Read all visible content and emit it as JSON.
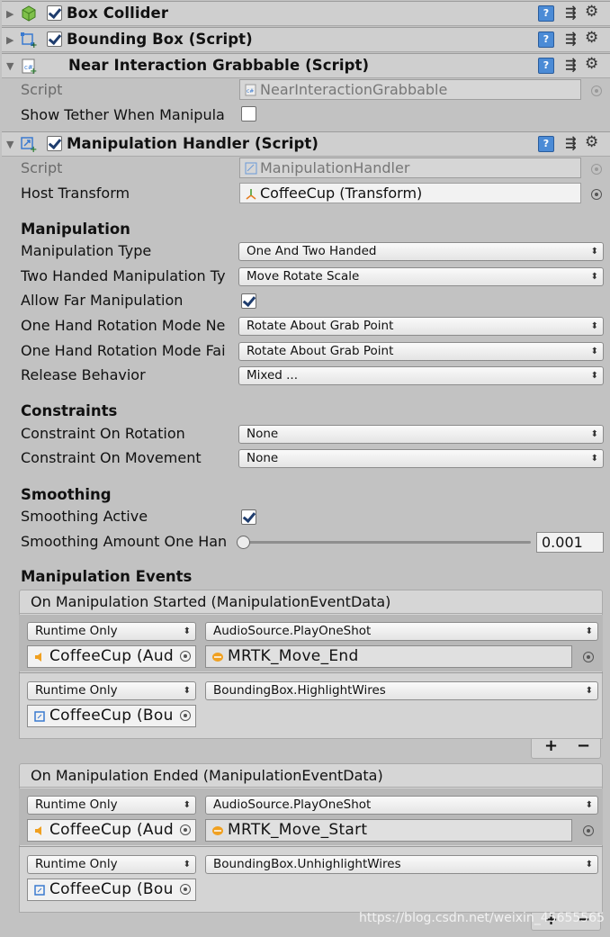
{
  "components": [
    {
      "title": "Box Collider",
      "icon": "box-collider-icon",
      "checked": true
    },
    {
      "title": "Bounding Box (Script)",
      "icon": "bounding-box-script-icon",
      "checked": true
    },
    {
      "title": "Near Interaction Grabbable (Script)",
      "icon": "script-icon",
      "checked": false
    },
    {
      "title": "Manipulation Handler (Script)",
      "icon": "manipulation-handler-icon",
      "checked": true
    }
  ],
  "grabbable": {
    "script_label": "Script",
    "script_value": "NearInteractionGrabbable",
    "tether_label": "Show Tether When Manipula",
    "tether_checked": false
  },
  "handler": {
    "script_label": "Script",
    "script_value": "ManipulationHandler",
    "host_label": "Host Transform",
    "host_value": "CoffeeCup (Transform)"
  },
  "manipulation": {
    "header": "Manipulation",
    "rows": [
      {
        "label": "Manipulation Type",
        "value": "One And Two Handed"
      },
      {
        "label": "Two Handed Manipulation Ty",
        "value": "Move Rotate Scale"
      },
      {
        "label": "Allow Far Manipulation",
        "checkbox": true
      },
      {
        "label": "One Hand Rotation Mode Ne",
        "value": "Rotate About Grab Point"
      },
      {
        "label": "One Hand Rotation Mode Fai",
        "value": "Rotate About Grab Point"
      },
      {
        "label": "Release Behavior",
        "value": "Mixed ..."
      }
    ]
  },
  "constraints": {
    "header": "Constraints",
    "rotation_label": "Constraint On Rotation",
    "rotation_value": "None",
    "movement_label": "Constraint On Movement",
    "movement_value": "None"
  },
  "smoothing": {
    "header": "Smoothing",
    "active_label": "Smoothing Active",
    "active_checked": true,
    "amount_label": "Smoothing Amount One Han",
    "amount_value": "0.001",
    "amount_fraction": 0.001
  },
  "events": {
    "header": "Manipulation Events",
    "started": {
      "title": "On Manipulation Started (ManipulationEventData)",
      "listeners": [
        {
          "mode": "Runtime Only",
          "function": "AudioSource.PlayOneShot",
          "target": "CoffeeCup (Aud",
          "argument": "MRTK_Move_End"
        },
        {
          "mode": "Runtime Only",
          "function": "BoundingBox.HighlightWires",
          "target": "CoffeeCup (Bou"
        }
      ]
    },
    "ended": {
      "title": "On Manipulation Ended (ManipulationEventData)",
      "listeners": [
        {
          "mode": "Runtime Only",
          "function": "AudioSource.PlayOneShot",
          "target": "CoffeeCup (Aud",
          "argument": "MRTK_Move_Start"
        },
        {
          "mode": "Runtime Only",
          "function": "BoundingBox.UnhighlightWires",
          "target": "CoffeeCup (Bou"
        }
      ]
    },
    "add_label": "+",
    "remove_label": "−"
  },
  "watermark": "https://blog.csdn.net/weixin_45655565",
  "colors": {
    "checkmark": "#1f3d6e",
    "script_icon": "#4b8bd6",
    "audio_icon": "#f0a020"
  }
}
